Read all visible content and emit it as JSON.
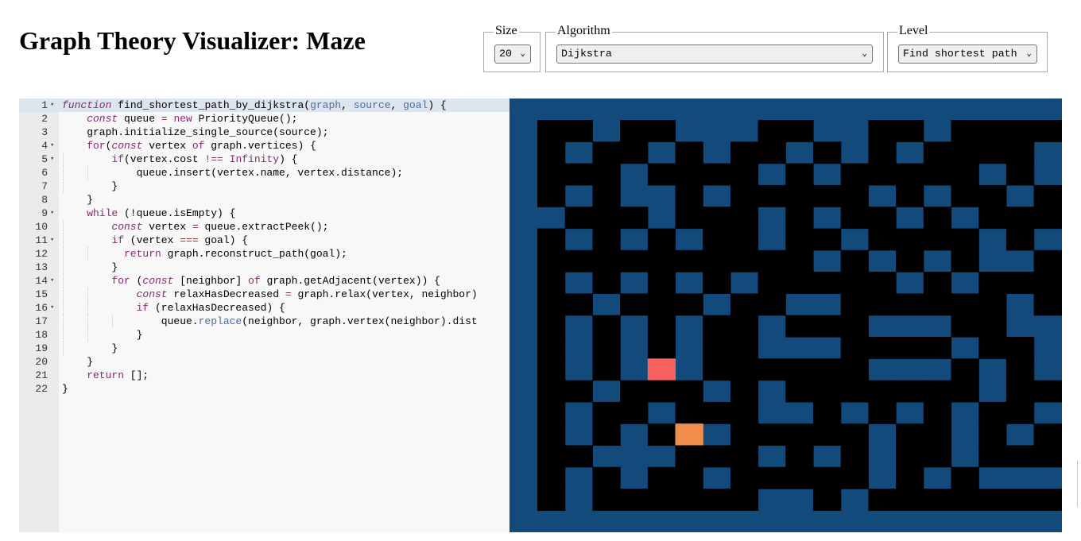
{
  "title": "Graph Theory Visualizer: Maze",
  "controls": {
    "size": {
      "legend": "Size",
      "value": "20"
    },
    "algorithm": {
      "legend": "Algorithm",
      "value": "Dijkstra"
    },
    "level": {
      "legend": "Level",
      "value": "Find shortest path"
    }
  },
  "editor": {
    "lines": [
      {
        "n": "1",
        "fold": true,
        "indent": 0,
        "active": true,
        "tokens": [
          {
            "t": "function",
            "c": "kwi"
          },
          {
            "t": " find_shortest_path_by_dijkstra("
          },
          {
            "t": "graph",
            "c": "pm"
          },
          {
            "t": ", "
          },
          {
            "t": "source",
            "c": "pm"
          },
          {
            "t": ", "
          },
          {
            "t": "goal",
            "c": "pm"
          },
          {
            "t": ") {"
          }
        ]
      },
      {
        "n": "2",
        "fold": false,
        "indent": 1,
        "tokens": [
          {
            "t": "const",
            "c": "kwi"
          },
          {
            "t": " queue "
          },
          {
            "t": "=",
            "c": "op"
          },
          {
            "t": " "
          },
          {
            "t": "new",
            "c": "kw"
          },
          {
            "t": " PriorityQueue();"
          }
        ]
      },
      {
        "n": "3",
        "fold": false,
        "indent": 1,
        "tokens": [
          {
            "t": "graph.initialize_single_source(source);"
          }
        ]
      },
      {
        "n": "4",
        "fold": true,
        "indent": 1,
        "tokens": [
          {
            "t": "for",
            "c": "kw"
          },
          {
            "t": "("
          },
          {
            "t": "const",
            "c": "kwi"
          },
          {
            "t": " vertex "
          },
          {
            "t": "of",
            "c": "kw"
          },
          {
            "t": " graph.vertices) {"
          }
        ]
      },
      {
        "n": "5",
        "fold": true,
        "indent": 2,
        "tokens": [
          {
            "t": "if",
            "c": "kw"
          },
          {
            "t": "(vertex.cost "
          },
          {
            "t": "!==",
            "c": "op"
          },
          {
            "t": " "
          },
          {
            "t": "Infinity",
            "c": "st"
          },
          {
            "t": ") {"
          }
        ]
      },
      {
        "n": "6",
        "fold": false,
        "indent": 3,
        "tokens": [
          {
            "t": "queue.insert(vertex.name, vertex.distance);"
          }
        ]
      },
      {
        "n": "7",
        "fold": false,
        "indent": 2,
        "tokens": [
          {
            "t": "}"
          }
        ]
      },
      {
        "n": "8",
        "fold": false,
        "indent": 1,
        "tokens": [
          {
            "t": "}"
          }
        ]
      },
      {
        "n": "9",
        "fold": true,
        "indent": 1,
        "tokens": [
          {
            "t": "while",
            "c": "kw"
          },
          {
            "t": " (!queue.isEmpty) {"
          }
        ]
      },
      {
        "n": "10",
        "fold": false,
        "indent": 2,
        "tokens": [
          {
            "t": "const",
            "c": "kwi"
          },
          {
            "t": " vertex "
          },
          {
            "t": "=",
            "c": "op"
          },
          {
            "t": " queue.extractPeek();"
          }
        ]
      },
      {
        "n": "11",
        "fold": true,
        "indent": 2,
        "tokens": [
          {
            "t": "if",
            "c": "kw"
          },
          {
            "t": " (vertex "
          },
          {
            "t": "===",
            "c": "op"
          },
          {
            "t": " goal) {"
          }
        ]
      },
      {
        "n": "12",
        "fold": false,
        "indent": 2.5,
        "tokens": [
          {
            "t": "return",
            "c": "kw"
          },
          {
            "t": " graph.reconstruct_path(goal);"
          }
        ]
      },
      {
        "n": "13",
        "fold": false,
        "indent": 2,
        "tokens": [
          {
            "t": "}"
          }
        ]
      },
      {
        "n": "14",
        "fold": true,
        "indent": 2,
        "tokens": [
          {
            "t": "for",
            "c": "kw"
          },
          {
            "t": " ("
          },
          {
            "t": "const",
            "c": "kwi"
          },
          {
            "t": " [neighbor] "
          },
          {
            "t": "of",
            "c": "kw"
          },
          {
            "t": " graph.getAdjacent(vertex)) {"
          }
        ]
      },
      {
        "n": "15",
        "fold": false,
        "indent": 3,
        "tokens": [
          {
            "t": "const",
            "c": "kwi"
          },
          {
            "t": " relaxHasDecreased "
          },
          {
            "t": "=",
            "c": "op"
          },
          {
            "t": " graph.relax(vertex, neighbor)"
          }
        ]
      },
      {
        "n": "16",
        "fold": true,
        "indent": 3,
        "tokens": [
          {
            "t": "if",
            "c": "kw"
          },
          {
            "t": " (relaxHasDecreased) {"
          }
        ]
      },
      {
        "n": "17",
        "fold": false,
        "indent": 4,
        "tokens": [
          {
            "t": "queue."
          },
          {
            "t": "replace",
            "c": "pm"
          },
          {
            "t": "(neighbor, graph.vertex(neighbor).dist"
          }
        ]
      },
      {
        "n": "18",
        "fold": false,
        "indent": 3,
        "tokens": [
          {
            "t": "}"
          }
        ]
      },
      {
        "n": "19",
        "fold": false,
        "indent": 2,
        "tokens": [
          {
            "t": "}"
          }
        ]
      },
      {
        "n": "20",
        "fold": false,
        "indent": 1,
        "tokens": [
          {
            "t": "}"
          }
        ]
      },
      {
        "n": "21",
        "fold": false,
        "indent": 1,
        "tokens": [
          {
            "t": "return",
            "c": "kw"
          },
          {
            "t": " [];"
          }
        ]
      },
      {
        "n": "22",
        "fold": false,
        "indent": 0,
        "tokens": [
          {
            "t": "}"
          }
        ]
      }
    ]
  },
  "maze": {
    "colors": {
      "background": "#134a7c",
      "wall": "#000000",
      "open": "#134a7c",
      "start": "#f96161",
      "goal": "#ef8d4c"
    },
    "cols": 19,
    "rows": 14,
    "rows_data": [
      "WWOWWOOOWWOOWWOWWWW",
      "WOWWOWOWWOWOWOWWWWO",
      "WWWOWWWWOWOWWWWWOWO",
      "WOWOOWOWWWWWOWOWWOW",
      "OWWWOWWWOWOWWOWOWWW",
      "WOWOWOWWOWWOWWWWOWO",
      "WWWWWWWWWWOWOWOWOOW",
      "WOWOWOWOWWWWWOWOWWW",
      "WWOWWWOWWOOWWWWWWOW",
      "WOWOWOWWOWWWOOOWWOO",
      "WOWOWOWWOOOWWWWOWWO",
      "WOWOSOWWWWWWOOOWOWO",
      "WWOWWWOWOWWWWWWWOWW",
      "WOWWOWWWOOWOWOWOWWO",
      "WOWOWGOWWWWWOWWOWOW",
      "WWOOOWWWOWOWOWWOWWW",
      "WOWOWWOWWWWWOWOWOOO",
      "WOWWWWWWOOWOWWWWWWW"
    ]
  }
}
